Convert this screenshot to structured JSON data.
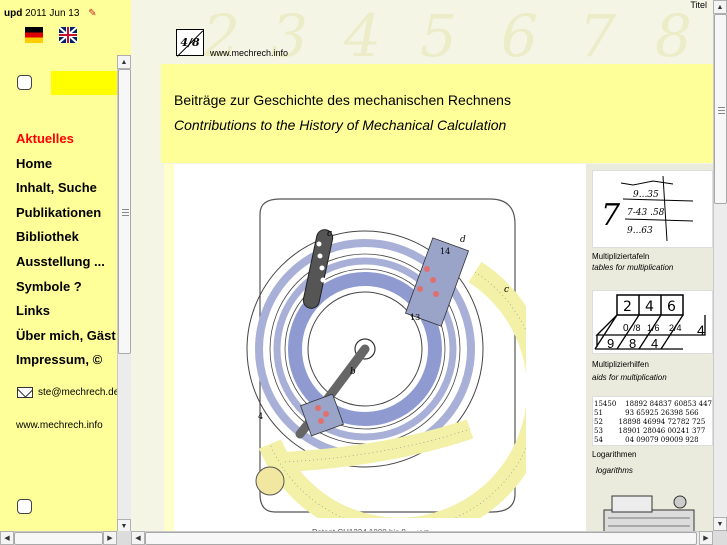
{
  "left_frame": {
    "update": {
      "label": "upd",
      "date": "2011 Jun 13"
    },
    "languages": [
      {
        "name": "Deutsch",
        "icon": "german-flag-icon"
      },
      {
        "name": "English",
        "icon": "uk-flag-icon"
      }
    ],
    "nav": [
      {
        "label": "Aktuelles",
        "active": true
      },
      {
        "label": "Home"
      },
      {
        "label": "Inhalt, Suche"
      },
      {
        "label": "Publikationen"
      },
      {
        "label": "Bibliothek"
      },
      {
        "label": "Ausstellung ..."
      },
      {
        "label": "Symbole ?"
      },
      {
        "label": "Links"
      },
      {
        "label": "Über mich, Gäst"
      },
      {
        "label": "Impressum, ©"
      }
    ],
    "email": "ste@mechrech.de",
    "site": "www.mechrech.info",
    "colors": {
      "background": "#ffff99",
      "active": "#ff0000",
      "search_box": "#ffff00"
    }
  },
  "right_frame": {
    "titel": "Titel",
    "ghost_digits": [
      "2",
      "3",
      "4",
      "5",
      "6",
      "7",
      "8"
    ],
    "logo": {
      "text": "4/8",
      "url": "www.mechrech.info"
    },
    "header": {
      "german": "Beiträge zur Geschichte des mechanischen Rechnens",
      "english": "Contributions to the History of Mechanical Calculation"
    },
    "figure_caption": "Patent CH1234 1000 bis 8 ... xyz",
    "sidebar": [
      {
        "de": "Multipliziertafeln",
        "en": "tables for multiplication"
      },
      {
        "de": "Multiplizierhilfen",
        "en": "aids for multiplication",
        "grid_top": [
          "2",
          "4",
          "6"
        ],
        "grid_bottom": [
          "9",
          "8",
          "4"
        ]
      },
      {
        "de": "Logarithmen",
        "en": "logarithms",
        "table": [
          "15450    18892 84837 60853 447",
          "51          93 65925 26398 566",
          "52       18898 46994 72782 725",
          "53       18901 28046 00241 377",
          "54          04 09079 09009 928"
        ]
      },
      {
        "de": "",
        "en": ""
      }
    ]
  }
}
